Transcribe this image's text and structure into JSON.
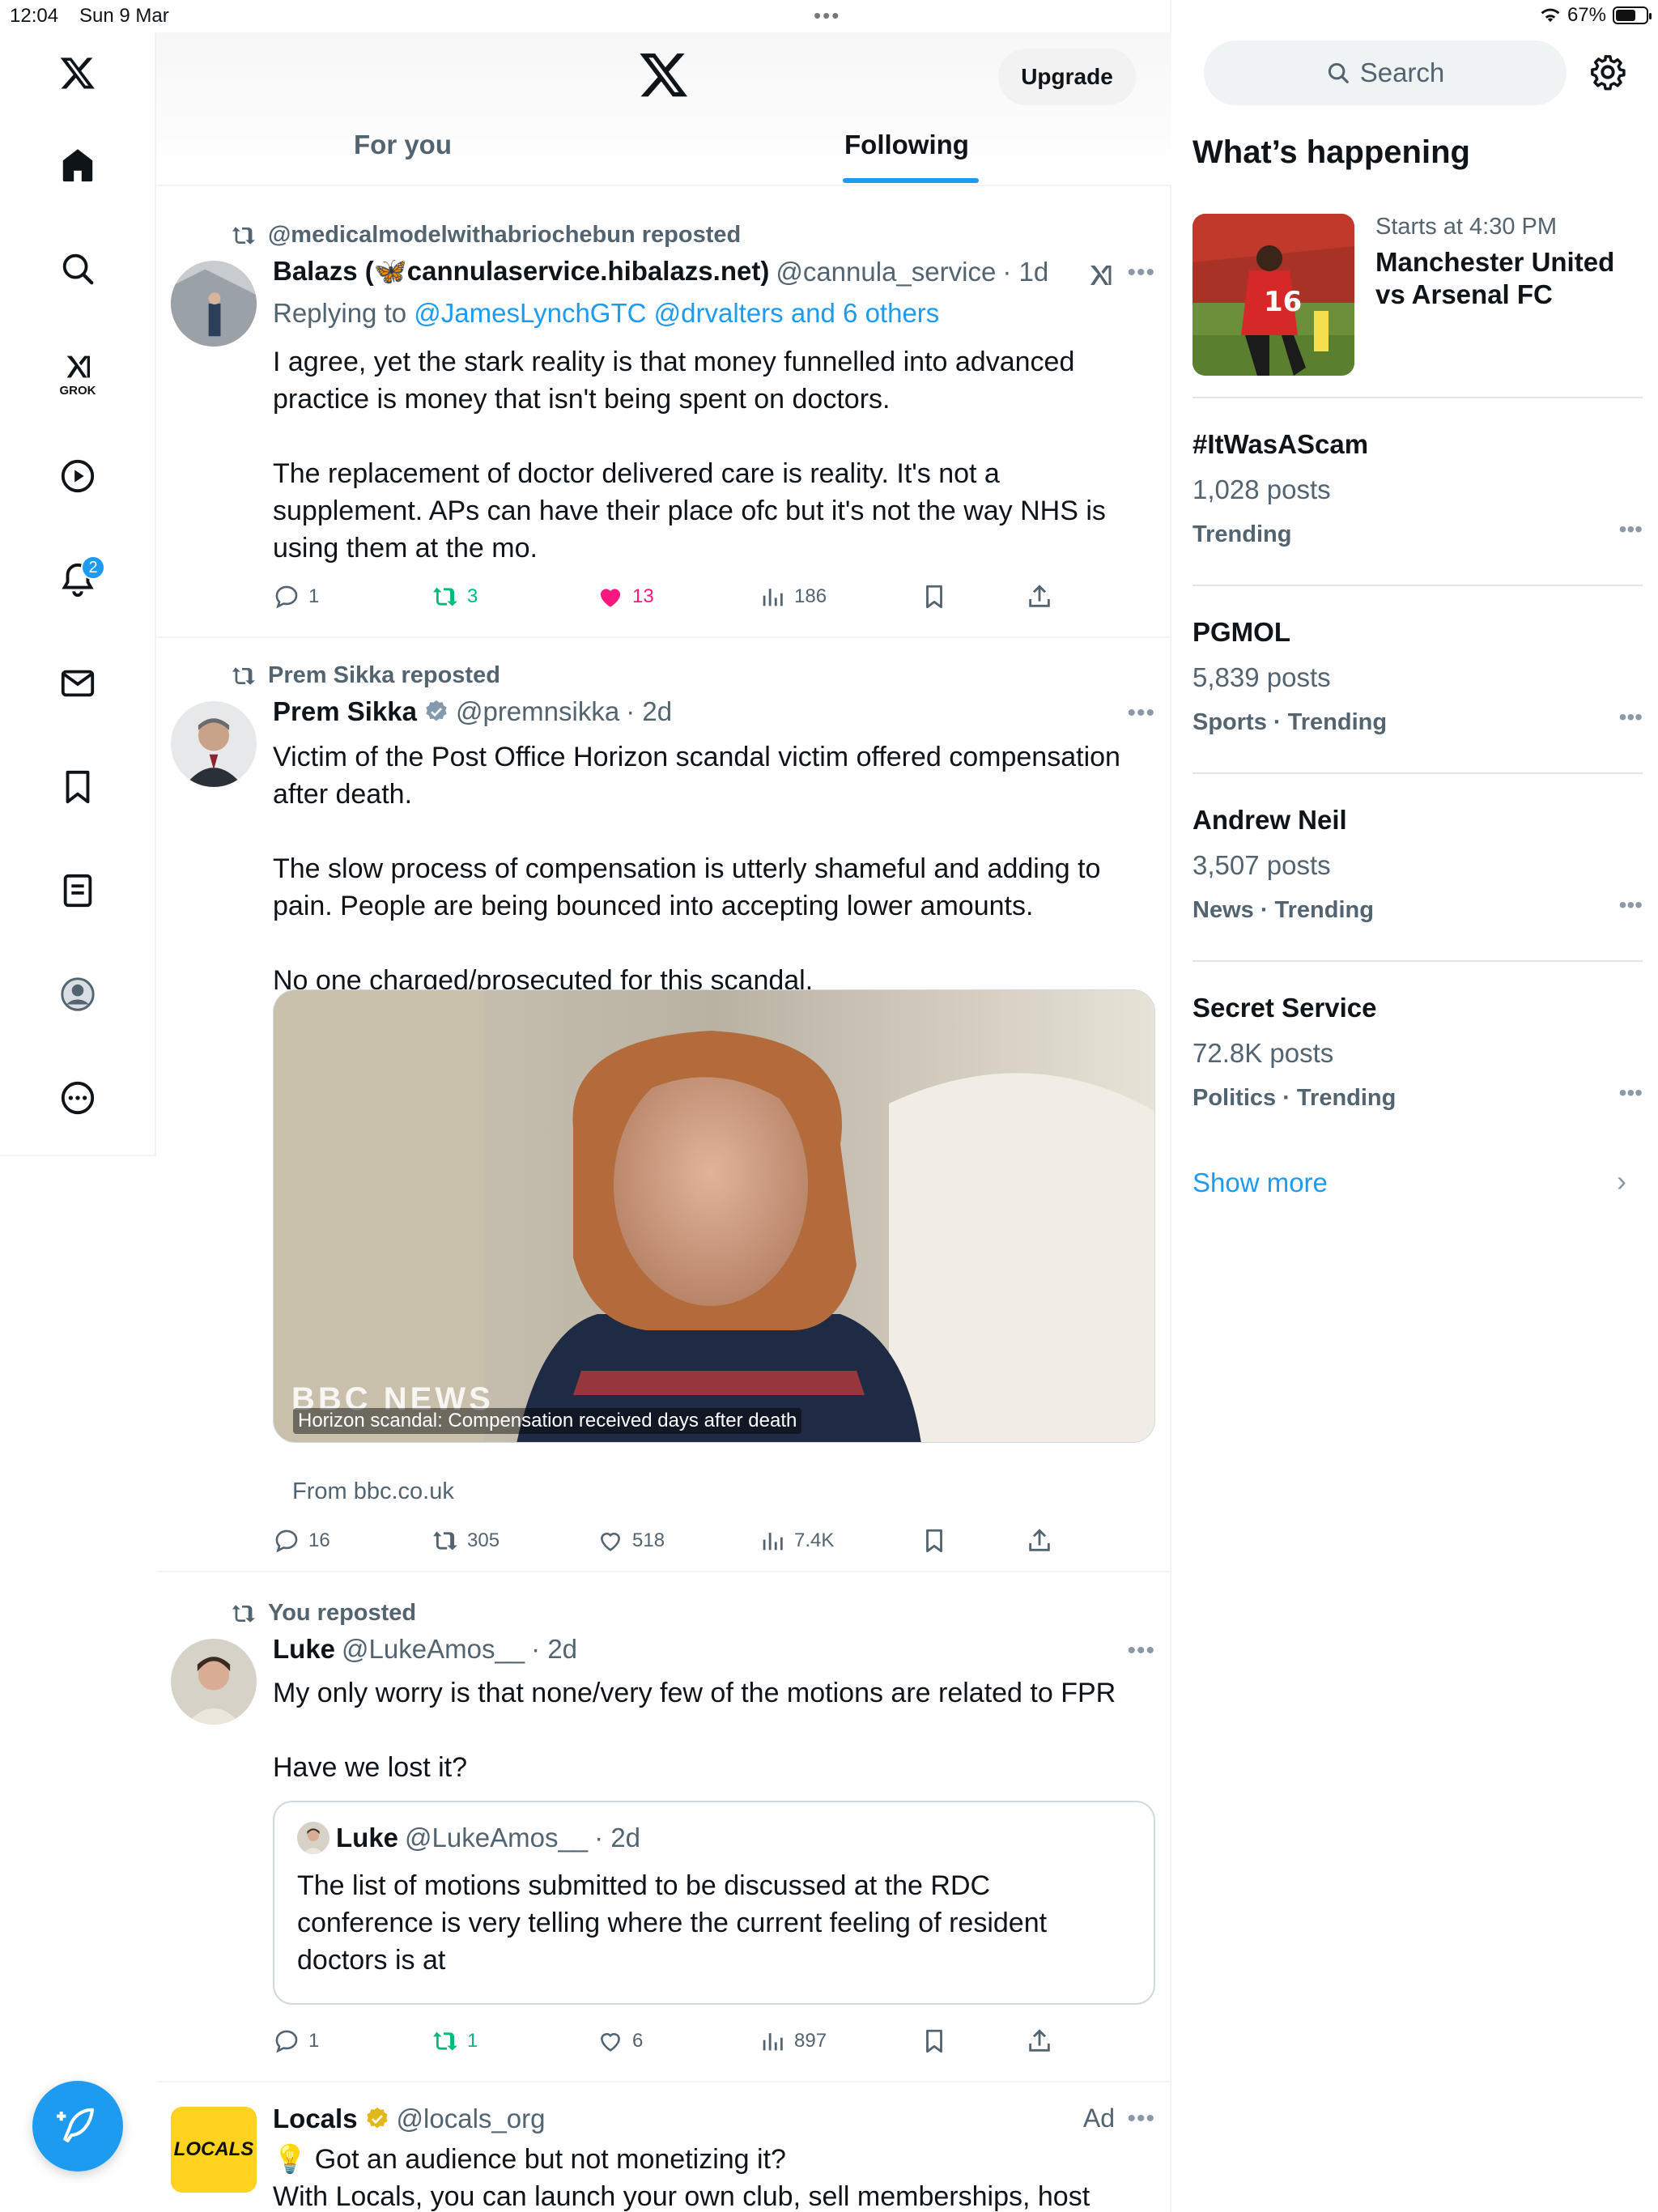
{
  "status_bar": {
    "time": "12:04",
    "date": "Sun 9 Mar",
    "battery": "67%",
    "battery_level": 0.67
  },
  "nav": {
    "grok_label": "GROK",
    "notification_count": "2"
  },
  "header": {
    "upgrade_label": "Upgrade",
    "tabs": [
      {
        "label": "For you"
      },
      {
        "label": "Following"
      }
    ]
  },
  "tweets": [
    {
      "repost_by": "@medicalmodelwithabriochebun reposted",
      "name": "Balazs (🦋cannulaservice.hibalazs.net)",
      "handle": "@cannula_service",
      "time": "· 1d",
      "replying_prefix": "Replying to ",
      "replying_to": "@JamesLynchGTC @drvalters and 6 others",
      "text": "I agree, yet the stark reality is that money funnelled into advanced practice is money that isn't being spent on doctors.\n\nThe replacement of doctor delivered care is reality. It's not a supplement. APs can have their place ofc but it's not the way NHS is using them at the mo.",
      "replies": "1",
      "reposts": "3",
      "likes": "13",
      "views": "186"
    },
    {
      "repost_by": "Prem Sikka reposted",
      "name": "Prem Sikka",
      "handle": "@premnsikka",
      "time": "· 2d",
      "text": "Victim of the Post Office Horizon scandal victim offered compensation after death.\n\nThe slow process of compensation is utterly shameful and adding to pain. People are being bounced into accepting lower amounts.\n\nNo one charged/prosecuted for this scandal.",
      "media_caption": "Horizon scandal: Compensation received days after death",
      "media_mark": "BBC NEWS",
      "from": "From bbc.co.uk",
      "replies": "16",
      "reposts": "305",
      "likes": "518",
      "views": "7.4K"
    },
    {
      "repost_by": "You reposted",
      "name": "Luke",
      "handle": "@LukeAmos__",
      "time": "· 2d",
      "text": "My only worry is that none/very few of the motions are related to FPR\n\nHave we lost it?",
      "quote": {
        "name": "Luke",
        "handle": "@LukeAmos__",
        "time": "· 2d",
        "text": "The list of motions submitted to be discussed at the RDC conference is very telling where the current feeling of resident doctors is at"
      },
      "replies": "1",
      "reposts": "1",
      "likes": "6",
      "views": "897"
    },
    {
      "name": "Locals",
      "handle": "@locals_org",
      "ad_label": "Ad",
      "logo_text": "LOCALS",
      "text": "💡 Got an audience but not monetizing it?\nWith Locals, you can launch your own club, sell memberships, host"
    }
  ],
  "sidebar": {
    "search_placeholder": "Search",
    "title": "What’s happening",
    "event": {
      "sub": "Starts at 4:30 PM",
      "title": "Manchester United vs Arsenal FC"
    },
    "trends": [
      {
        "name": "#ItWasAScam",
        "count": "1,028 posts",
        "category": "Trending"
      },
      {
        "name": "PGMOL",
        "count": "5,839 posts",
        "category": "Sports · Trending"
      },
      {
        "name": "Andrew Neil",
        "count": "3,507 posts",
        "category": "News · Trending"
      },
      {
        "name": "Secret Service",
        "count": "72.8K posts",
        "category": "Politics · Trending"
      }
    ],
    "show_more": "Show more"
  },
  "colors": {
    "accent": "#1d9bf0",
    "repost_green": "#00ba7c",
    "like_pink": "#f91880",
    "muted": "#536471"
  }
}
